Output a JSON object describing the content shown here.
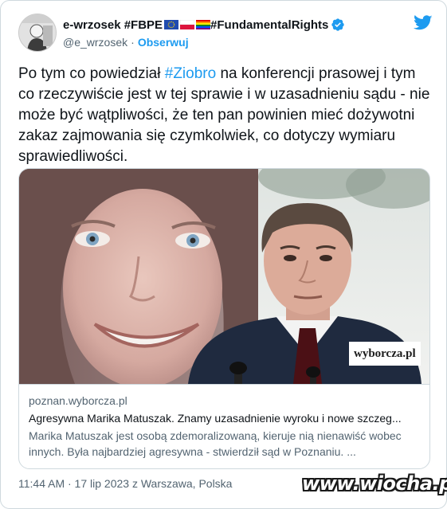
{
  "author": {
    "display_name": "e-wrzosek #FBPE",
    "display_name_suffix": "#FundamentalRights",
    "handle": "@e_wrzosek",
    "separator": "·",
    "follow_label": "Obserwuj",
    "verified_color": "#1d9bf0",
    "flags": [
      "eu-flag-icon",
      "poland-flag-icon",
      "rainbow-flag-icon"
    ]
  },
  "tweet": {
    "text_part1": "Po tym co powiedział ",
    "hashtag": "#Ziobro",
    "text_part2": " na konferencji prasowej i tym co rzeczywiście jest w tej sprawie i w uzasadnieniu sądu - nie może być wątpliwości, że ten pan powinien mieć  dożywotni zakaz zajmowania się czymkolwiek, co dotyczy wymiaru sprawiedliwości."
  },
  "card": {
    "image_watermark_main": "wyborcza",
    "image_watermark_tld": ".pl",
    "domain": "poznan.wyborcza.pl",
    "title": "Agresywna Marika Matuszak. Znamy uzasadnienie wyroku i nowe szczeg...",
    "description": "Marika Matuszak jest osobą zdemoralizowaną, kieruje nią nienawiść wobec innych. Była najbardziej agresywna - stwierdził sąd w Poznaniu. ..."
  },
  "footer": {
    "timestamp": "11:44 AM · 17 lip 2023 z Warszawa, Polska",
    "site_watermark": "www.wiocha.pl"
  },
  "colors": {
    "accent": "#1d9bf0",
    "text": "#0f1419",
    "secondary": "#536471",
    "border": "#cfd9de"
  }
}
